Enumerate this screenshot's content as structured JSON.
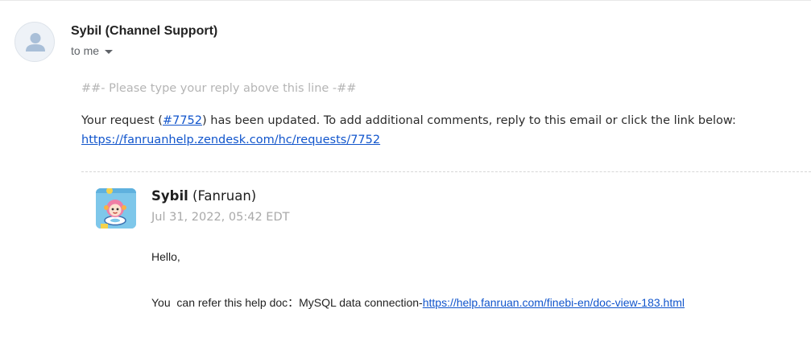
{
  "email": {
    "sender": "Sybil (Channel Support)",
    "recipient_label": "to me",
    "reply_marker": "##- Please type your reply above this line -##",
    "request_prefix": "Your request (",
    "request_id": "#7752",
    "request_suffix": ") has been updated. To add additional comments, reply to this email or click the link below:",
    "request_url": "https://fanruanhelp.zendesk.com/hc/requests/7752"
  },
  "comment": {
    "author_first": "Sybil",
    "author_org": " (Fanruan)",
    "timestamp": "Jul 31, 2022, 05:42 EDT",
    "greeting": "Hello,",
    "refer_text": "You  can refer this help doc：MySQL data connection-",
    "doc_url": "https://help.fanruan.com/finebi-en/doc-view-183.html"
  },
  "colors": {
    "link": "#1155cc",
    "muted": "#b5b5b5",
    "agent_avatar_bg": "#7ec7ea"
  },
  "icons": {
    "sender_avatar": "person-icon",
    "recipient_toggle": "caret-down-icon",
    "agent_avatar": "cartoon-avatar"
  }
}
